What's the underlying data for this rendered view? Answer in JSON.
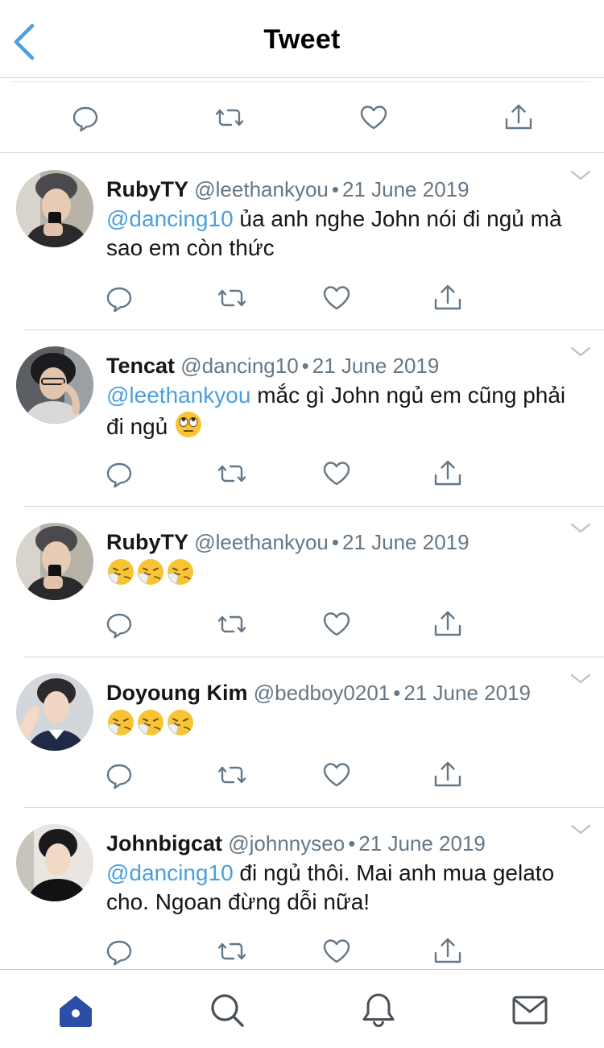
{
  "header": {
    "title": "Tweet",
    "back_icon": "chevron-left-icon"
  },
  "colors": {
    "accent": "#4a9fe0",
    "icon_gray": "#657786",
    "text": "#14171a",
    "home_active": "#2b4fa5"
  },
  "main_actions": [
    "reply-icon",
    "retweet-icon",
    "like-icon",
    "share-icon"
  ],
  "replies": [
    {
      "name": "RubyTY",
      "handle": "@leethankyou",
      "date": "21 June 2019",
      "mention": "@dancing10",
      "text": " ủa anh nghe John nói đi ngủ mà sao em còn thức"
    },
    {
      "name": "Tencat",
      "handle": "@dancing10",
      "date": "21 June 2019",
      "mention": "@leethankyou",
      "text": " mắc gì John ngủ em cũng phải đi ngủ",
      "emoji": "face-with-rolling-eyes"
    },
    {
      "name": "RubyTY",
      "handle": "@leethankyou",
      "date": "21 June 2019",
      "emojis": [
        "sneezing-face",
        "sneezing-face",
        "sneezing-face"
      ]
    },
    {
      "name": "Doyoung Kim",
      "handle": "@bedboy0201",
      "date": "21 June 2019",
      "emojis": [
        "sneezing-face",
        "sneezing-face",
        "sneezing-face"
      ]
    },
    {
      "name": "Johnbigcat",
      "handle": "@johnnyseo",
      "date": "21 June 2019",
      "mention": "@dancing10",
      "text": " đi ngủ thôi. Mai anh mua gelato cho. Ngoan đừng dỗi nữa!"
    }
  ],
  "dot": "•",
  "tabbar": [
    "home-icon",
    "search-icon",
    "notifications-bell-icon",
    "messages-envelope-icon"
  ]
}
